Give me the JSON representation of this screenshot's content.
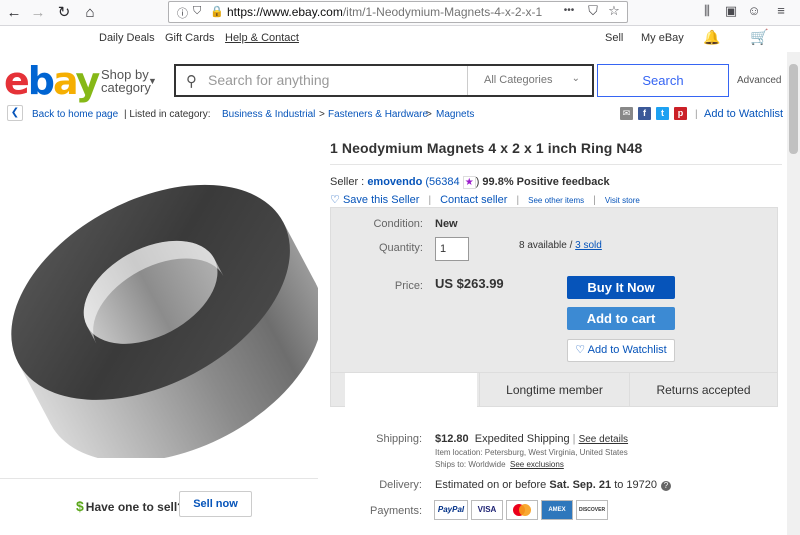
{
  "browser": {
    "url_host": "https://www.ebay.com",
    "url_path": "/itm/1-Neodymium-Magnets-4-x-2-x-1",
    "url_ellipsis": "...",
    "back_icon": "←",
    "forward_icon": "→",
    "reload_icon": "↻",
    "home_icon": "⌂",
    "menu_icon": "≡",
    "star_icon": "☆",
    "more_icon": "•••"
  },
  "topnav": {
    "deals": "Daily Deals",
    "gift": "Gift Cards",
    "help": "Help & Contact",
    "sell": "Sell",
    "myebay": "My eBay"
  },
  "header": {
    "logo_e": "e",
    "logo_b": "b",
    "logo_a": "a",
    "logo_y": "y",
    "shop_by": "Shop by",
    "category": "category",
    "search_placeholder": "Search for anything",
    "category_select": "All Categories",
    "search_button": "Search",
    "advanced": "Advanced"
  },
  "breadcrumb": {
    "back": "Back to home page",
    "listed": "| Listed in category:",
    "cat1": "Business & Industrial",
    "cat2": "Fasteners & Hardware",
    "cat3": "Magnets",
    "sep": ">",
    "watchlist": "Add to Watchlist"
  },
  "product": {
    "title": "1 Neodymium Magnets 4 x 2 x 1 inch Ring N48",
    "seller_label": "Seller :",
    "seller_name": "emovendo",
    "feedback_count": "(56384",
    "feedback_close": ")",
    "positive": "99.8% Positive feedback",
    "save_seller": "Save this Seller",
    "contact_seller": "Contact seller",
    "see_other": "See other items",
    "visit_store": "Visit store",
    "condition_label": "Condition:",
    "condition_value": "New",
    "quantity_label": "Quantity:",
    "quantity_value": "1",
    "available": "8 available /",
    "sold": "3 sold",
    "price_label": "Price:",
    "price": "US $263.99",
    "buy_now": "Buy It Now",
    "add_cart": "Add to cart",
    "add_watch": "Add to Watchlist",
    "badge1": "Longtime member",
    "badge2": "Returns accepted"
  },
  "shipping": {
    "label": "Shipping:",
    "cost": "$12.80",
    "method": "Expedited Shipping",
    "sep": "|",
    "see_details": "See details",
    "location": "Item location:  Petersburg, West Virginia, United States",
    "ships_to_label": "Ships to:  Worldwide",
    "see_exclusions": "See exclusions",
    "delivery_label": "Delivery:",
    "delivery_text": "Estimated on or before",
    "delivery_date": "Sat. Sep. 21",
    "delivery_to": "to 19720",
    "payments_label": "Payments:"
  },
  "payments": [
    "PayPal",
    "VISA",
    "MasterCard",
    "AMEX",
    "DISCOVER"
  ],
  "sell": {
    "question": "Have one to sell?",
    "button": "Sell now"
  },
  "colors": {
    "ebay_blue": "#0654ba",
    "buy_button": "#0654ba",
    "cart_button": "#3c8ad3",
    "panel_bg": "#e9e9e9"
  }
}
